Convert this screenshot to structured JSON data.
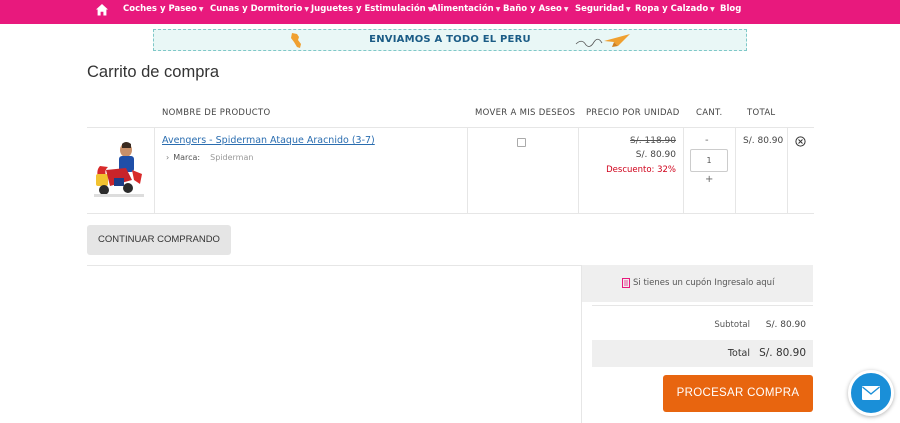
{
  "nav": {
    "items": [
      {
        "label": "Coches y Paseo",
        "has_caret": true
      },
      {
        "label": "Cunas y Dormitorio",
        "has_caret": true
      },
      {
        "label": "Juguetes y Estimulación",
        "has_caret": true
      },
      {
        "label": "Alimentación",
        "has_caret": true
      },
      {
        "label": "Baño y Aseo",
        "has_caret": true
      },
      {
        "label": "Seguridad",
        "has_caret": true
      },
      {
        "label": "Ropa y Calzado",
        "has_caret": true
      },
      {
        "label": "Blog",
        "has_caret": false
      }
    ],
    "home_icon": "home-icon",
    "bg_color": "#e8197d"
  },
  "banner": {
    "text": "ENVIAMOS A TODO EL PERU",
    "icons": [
      "peru-map-icon",
      "paper-plane-icon"
    ]
  },
  "page_title": "Carrito de compra",
  "table": {
    "headers": {
      "product": "NOMBRE DE PRODUCTO",
      "wishlist": "MOVER A MIS DESEOS",
      "unit_price": "PRECIO POR UNIDAD",
      "qty": "CANT.",
      "total": "TOTAL"
    },
    "rows": [
      {
        "name": "Avengers - Spiderman Ataque Aracnido (3-7)",
        "brand_label": "Marca:",
        "brand_value": "Spiderman",
        "old_price": "S/. 118.90",
        "price": "S/. 80.90",
        "discount": "Descuento: 32%",
        "qty": "1",
        "qty_minus": "-",
        "qty_plus": "+",
        "total": "S/. 80.90",
        "wishlist_checked": false
      }
    ]
  },
  "continue_button": "CONTINUAR COMPRANDO",
  "summary": {
    "coupon_text": "Si tienes un cupón Ingresalo aquí",
    "subtotal_label": "Subtotal",
    "subtotal_value": "S/. 80.90",
    "total_label": "Total",
    "total_value": "S/. 80.90",
    "process_button": "PROCESAR COMPRA"
  },
  "colors": {
    "accent_pink": "#e8197d",
    "process_orange": "#e8650f",
    "link_blue": "#2a6db0",
    "discount_red": "#d0021b",
    "fab_blue": "#1a8fd8"
  }
}
